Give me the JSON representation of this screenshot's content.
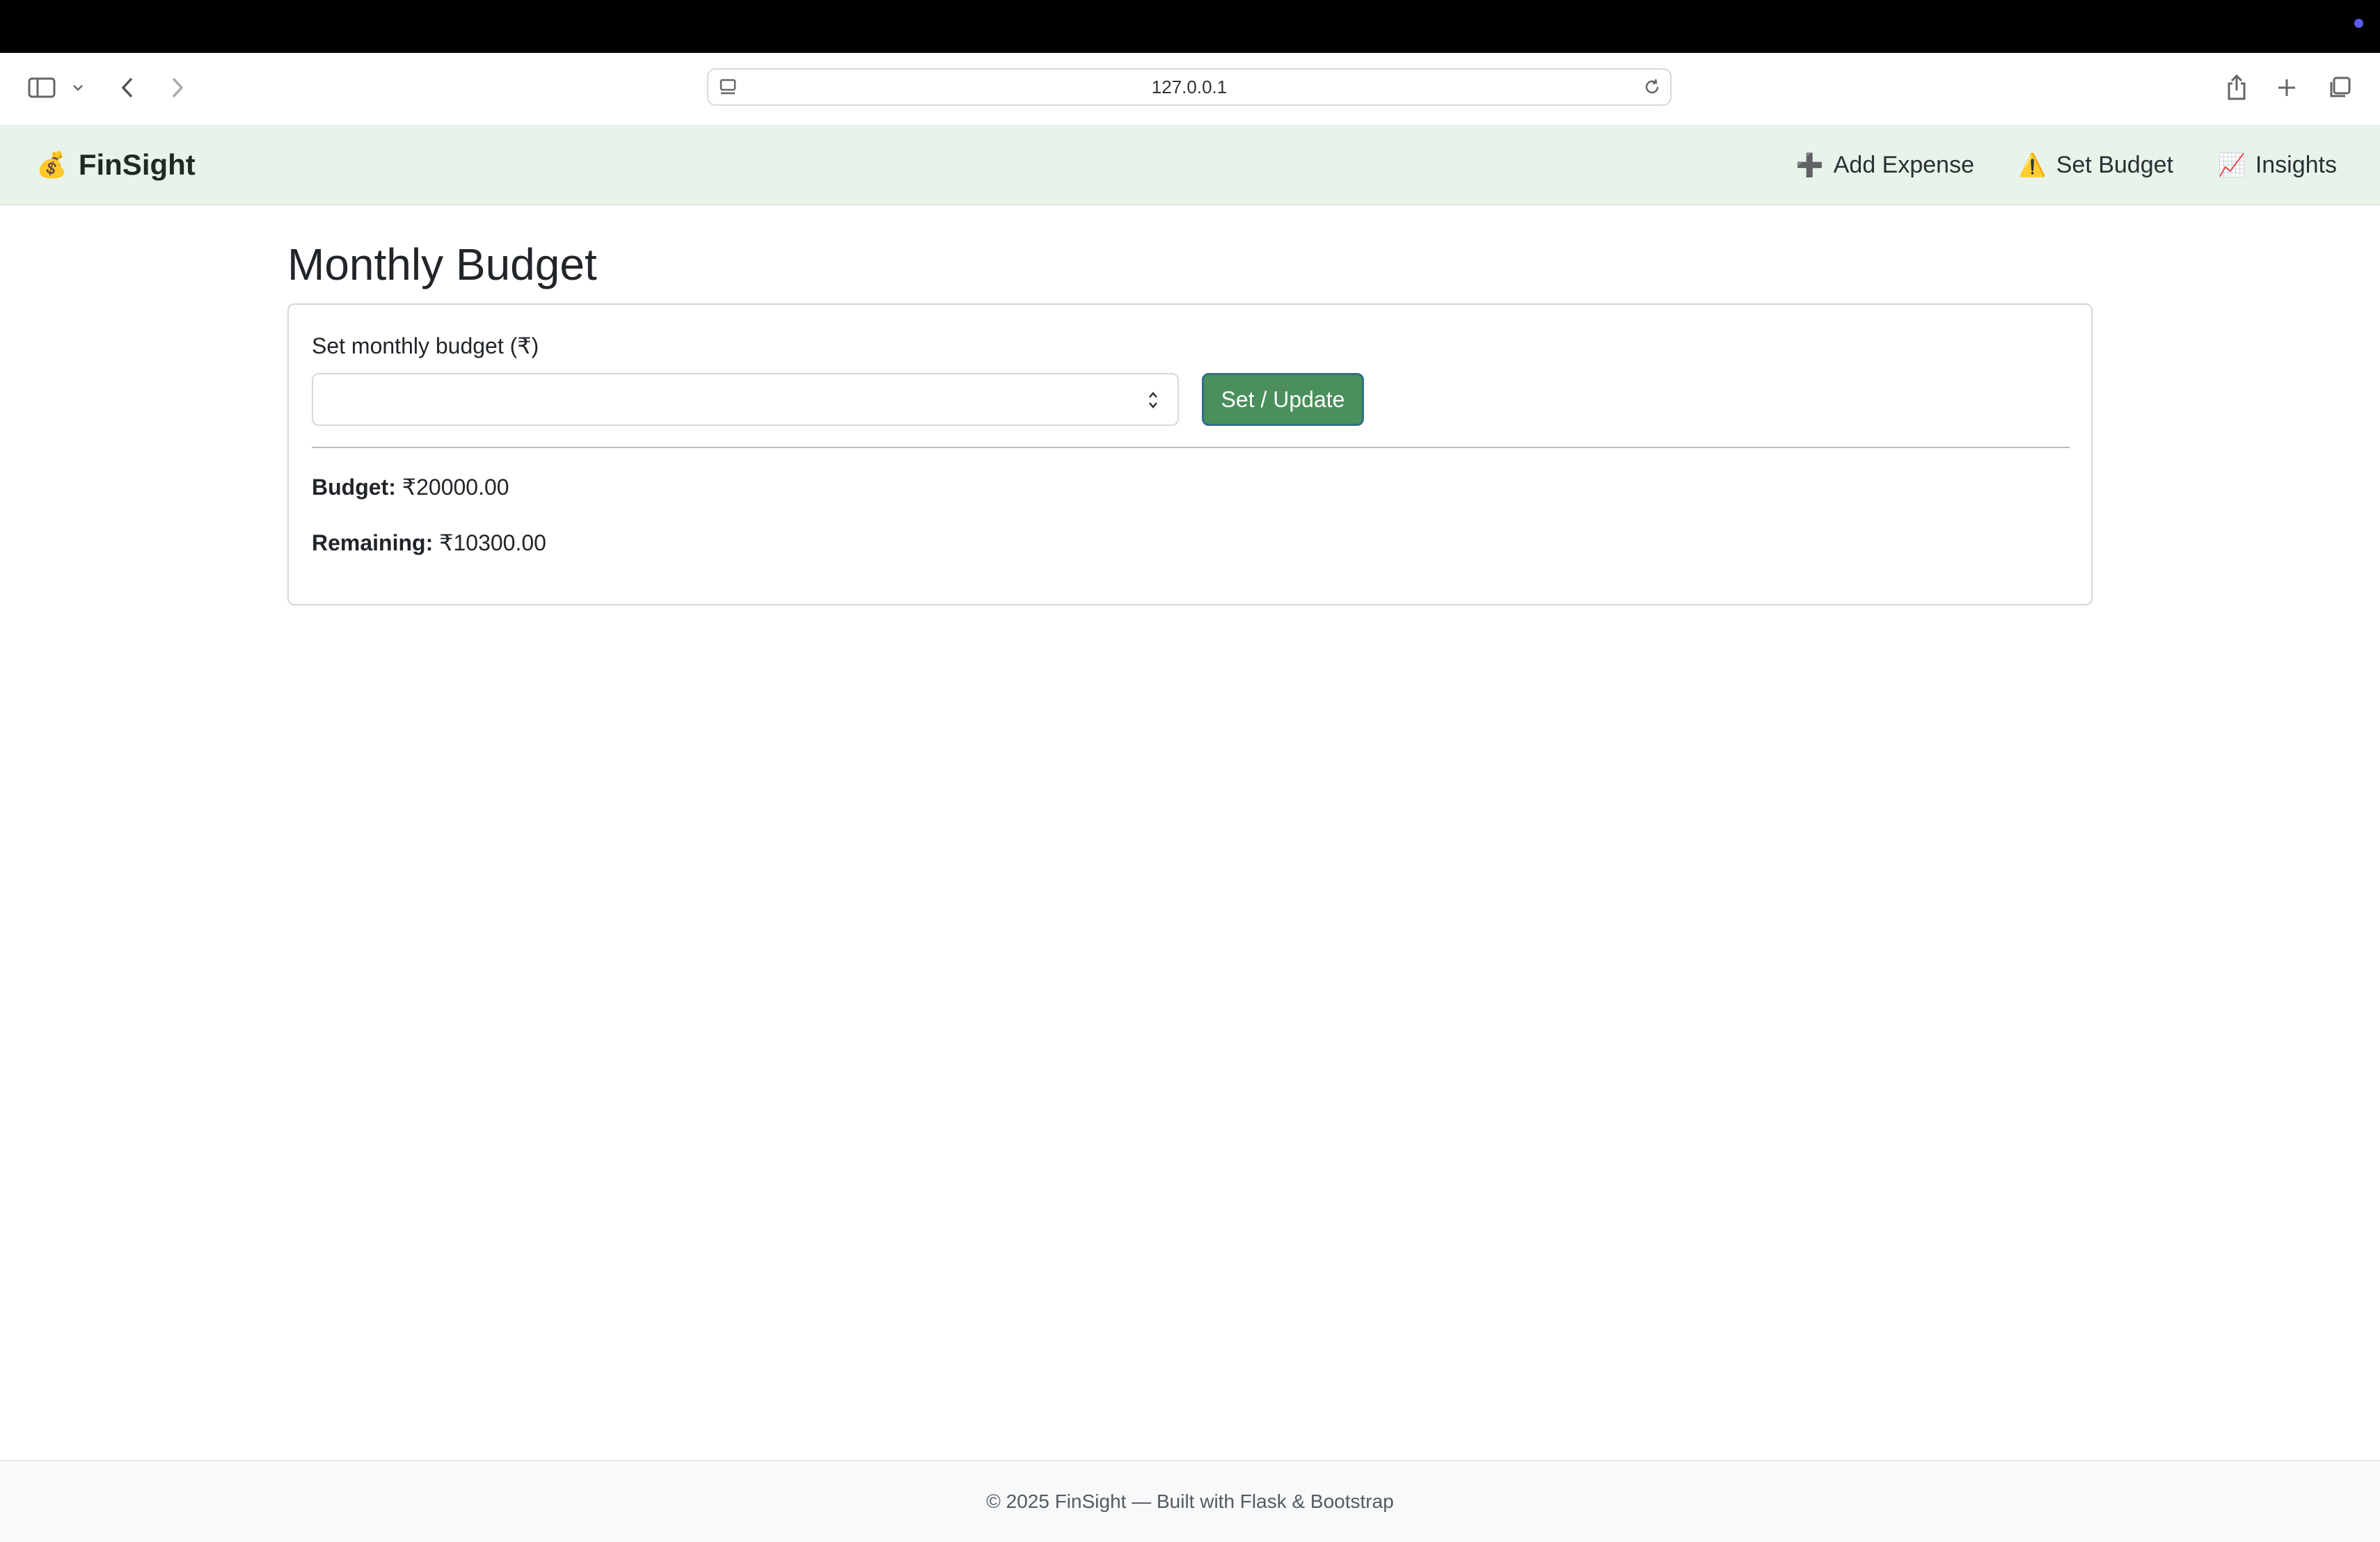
{
  "browser": {
    "url": "127.0.0.1"
  },
  "navbar": {
    "brand_emoji": "💰",
    "brand": "FinSight",
    "links": [
      {
        "icon": "➕",
        "label": "Add Expense"
      },
      {
        "icon": "⚠️",
        "label": "Set Budget"
      },
      {
        "icon": "📈",
        "label": "Insights"
      }
    ]
  },
  "page": {
    "title": "Monthly Budget",
    "form": {
      "label": "Set monthly budget (₹)",
      "input_value": "",
      "button": "Set / Update"
    },
    "budget_label": "Budget:",
    "budget_value": "₹20000.00",
    "remaining_label": "Remaining:",
    "remaining_value": "₹10300.00"
  },
  "footer": {
    "text": "© 2025 FinSight — Built with Flask & Bootstrap"
  },
  "colors": {
    "navbar_bg": "#e8f3ea",
    "button_bg": "#4a8f5c",
    "button_border": "#2f6f88"
  }
}
